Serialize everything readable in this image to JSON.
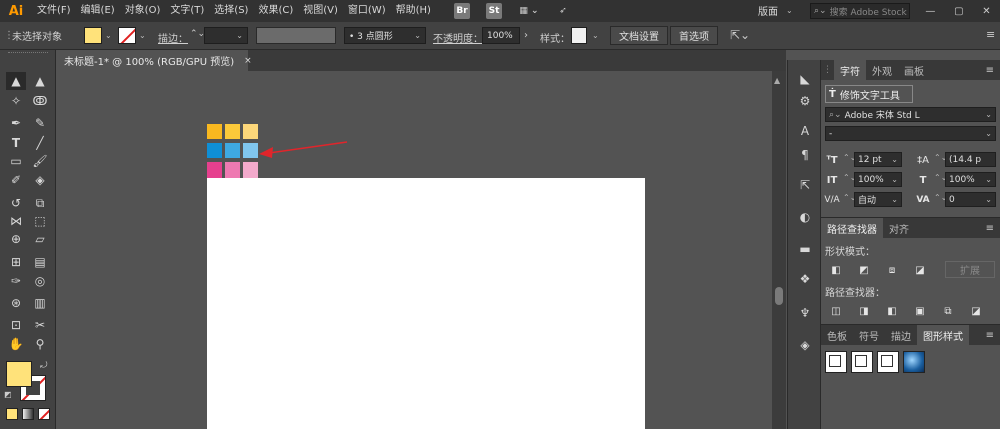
{
  "app": {
    "logo": "Ai"
  },
  "menu": [
    "文件(F)",
    "编辑(E)",
    "对象(O)",
    "文字(T)",
    "选择(S)",
    "效果(C)",
    "视图(V)",
    "窗口(W)",
    "帮助(H)"
  ],
  "menubar_right": {
    "bridge": "Br",
    "stock": "St",
    "workspace": "版面",
    "search_placeholder": "搜索 Adobe Stock"
  },
  "control": {
    "selection": "未选择对象",
    "stroke_label": "描边：",
    "brush": "• 3 点圆形",
    "opacity_label": "不透明度：",
    "opacity_value": "100%",
    "style_label": "样式：",
    "doc_setup": "文档设置",
    "prefs": "首选项",
    "fill_color": "#ffe27a"
  },
  "document": {
    "tab_title": "未标题-1* @ 100% (RGB/GPU 预览)",
    "close": "×"
  },
  "swatches": {
    "row1": [
      "#f9b81f",
      "#fbc93a",
      "#fcd77a"
    ],
    "row2": [
      "#0f8fd6",
      "#3ea9e2",
      "#80c6ee"
    ],
    "row3": [
      "#e6408e",
      "#ee79b1",
      "#f3aacc"
    ],
    "arrow_color": "#e1252b"
  },
  "character_panel": {
    "tabs": [
      "字符",
      "外观",
      "画板"
    ],
    "touch_type": "修饰文字工具",
    "font": "Adobe 宋体 Std L",
    "style": "-",
    "size": "12 pt",
    "leading": "(14.4 p",
    "vscale": "100%",
    "hscale": "100%",
    "kerning": "自动",
    "tracking": "0"
  },
  "pathfinder_panel": {
    "tabs": [
      "路径查找器",
      "对齐"
    ],
    "shape_modes": "形状模式：",
    "expand": "扩展",
    "pathfinders": "路径查找器："
  },
  "graphic_styles_panel": {
    "tabs": [
      "色板",
      "符号",
      "描边",
      "图形样式"
    ]
  }
}
